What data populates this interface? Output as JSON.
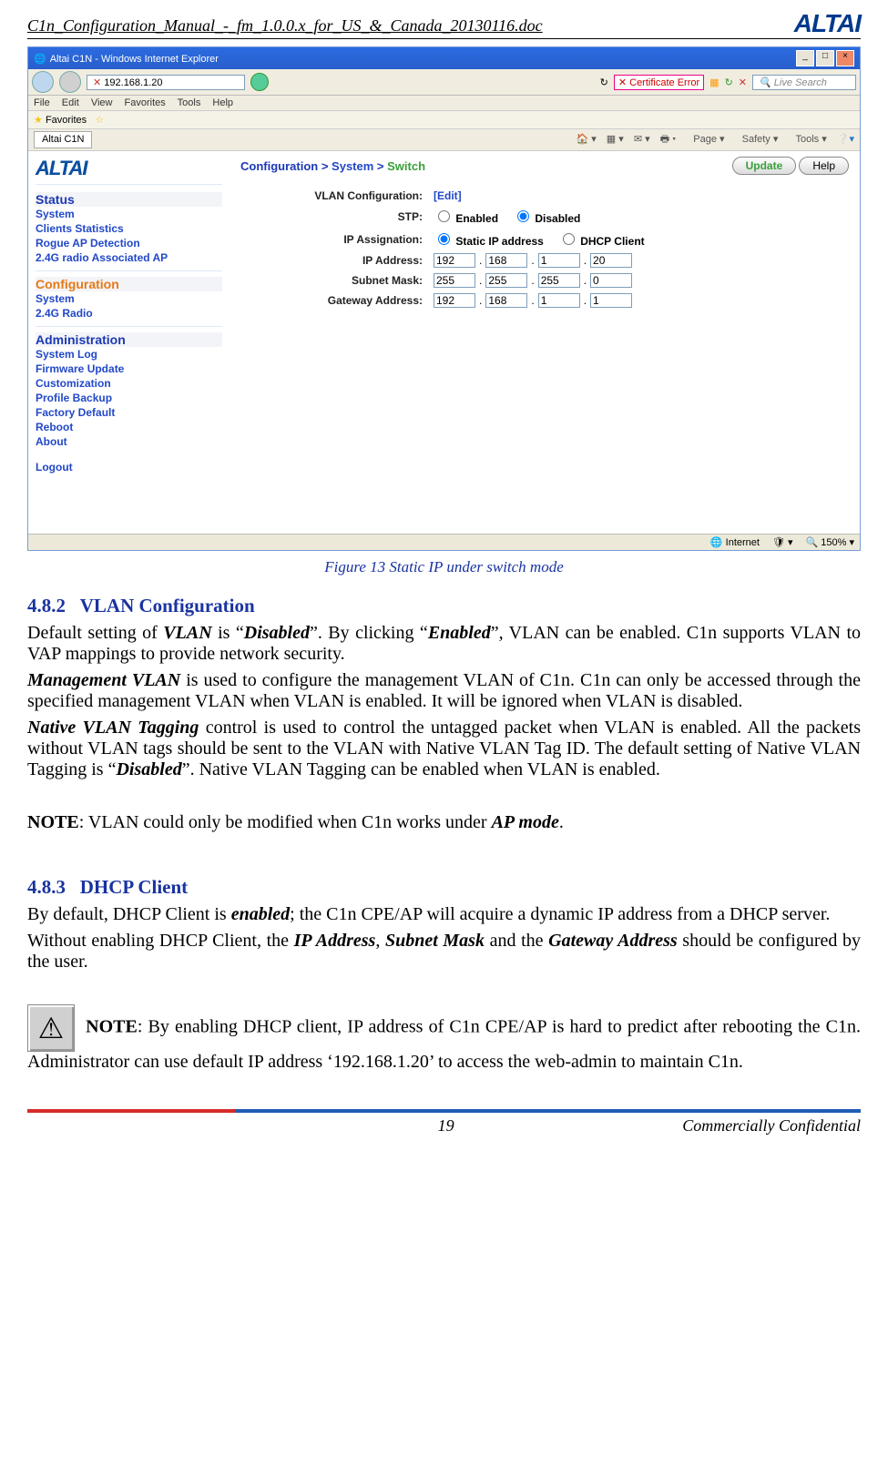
{
  "header": {
    "doc_title": "C1n_Configuration_Manual_-_fm_1.0.0.x_for_US_&_Canada_20130116.doc",
    "logo_text": "ALTAI"
  },
  "window": {
    "title": "Altai C1N - Windows Internet Explorer",
    "url": "192.168.1.20",
    "cert_error": "Certificate Error",
    "search_placeholder": "Live Search",
    "menubar": [
      "File",
      "Edit",
      "View",
      "Favorites",
      "Tools",
      "Help"
    ],
    "favorites_label": "Favorites",
    "tab_label": "Altai C1N",
    "toolbar_right": [
      "Page",
      "Safety",
      "Tools"
    ],
    "status_internet": "Internet",
    "status_zoom": "150%"
  },
  "sidebar": {
    "logo": "ALTAI",
    "status": {
      "heading": "Status",
      "items": [
        "System",
        "Clients Statistics",
        "Rogue AP Detection",
        "2.4G radio Associated AP"
      ]
    },
    "configuration": {
      "heading": "Configuration",
      "items": [
        "System",
        "2.4G Radio"
      ]
    },
    "administration": {
      "heading": "Administration",
      "items": [
        "System Log",
        "Firmware Update",
        "Customization",
        "Profile Backup",
        "Factory Default",
        "Reboot",
        "About"
      ]
    },
    "logout": "Logout"
  },
  "breadcrumb": {
    "label": "Configuration >",
    "l2": "System",
    "sep": ">",
    "l3": "Switch"
  },
  "buttons": {
    "update": "Update",
    "help": "Help"
  },
  "form": {
    "vlan_label": "VLAN Configuration:",
    "vlan_edit": "[Edit]",
    "stp_label": "STP:",
    "stp_enabled": "Enabled",
    "stp_disabled": "Disabled",
    "ip_assign_label": "IP Assignation:",
    "ip_static": "Static IP address",
    "ip_dhcp": "DHCP Client",
    "ip_addr_label": "IP Address:",
    "ip_addr": [
      "192",
      "168",
      "1",
      "20"
    ],
    "subnet_label": "Subnet Mask:",
    "subnet": [
      "255",
      "255",
      "255",
      "0"
    ],
    "gateway_label": "Gateway Address:",
    "gateway": [
      "192",
      "168",
      "1",
      "1"
    ]
  },
  "figure_caption": "Figure 13    Static IP under switch mode",
  "doc": {
    "h482_num": "4.8.2",
    "h482_title": "VLAN Configuration",
    "p1_a": "Default setting of ",
    "p1_vlan": "VLAN",
    "p1_b": " is “",
    "p1_disabled": "Disabled",
    "p1_c": "”. By clicking “",
    "p1_enabled": "Enabled",
    "p1_d": "”, VLAN can be enabled. C1n supports VLAN to VAP mappings to provide network security.",
    "p2_mv": "Management VLAN",
    "p2_rest": " is used to configure the management VLAN of C1n. C1n can only be accessed through the specified management VLAN when VLAN is enabled. It will be ignored when VLAN is disabled.",
    "p3_nvt": "Native VLAN Tagging",
    "p3_a": " control is used to control the untagged packet when VLAN is enabled. All the packets without VLAN tags should be sent to the VLAN with Native VLAN Tag ID. The default setting of Native VLAN Tagging is “",
    "p3_disabled": "Disabled",
    "p3_b": "”. Native VLAN Tagging can be enabled when VLAN is enabled.",
    "note1_label": "NOTE",
    "note1_rest": ": VLAN could only be modified when C1n works under ",
    "note1_ap": "AP mode",
    "note1_end": ".",
    "h483_num": "4.8.3",
    "h483_title": "DHCP Client",
    "p4_a": "By default, DHCP Client is ",
    "p4_en": "enabled",
    "p4_b": "; the C1n CPE/AP will acquire a dynamic IP address from a DHCP server.",
    "p5_a": "Without enabling DHCP Client, the ",
    "p5_ip": "IP Address",
    "p5_c1": ", ",
    "p5_sm": "Subnet Mask",
    "p5_c2": " and the ",
    "p5_gw": "Gateway Address",
    "p5_b": " should be configured by the user.",
    "note2_label": "NOTE",
    "note2_rest": ": By enabling DHCP client, IP address of C1n CPE/AP is hard to predict after rebooting the C1n. Administrator can use default IP address ‘192.168.1.20’ to access the web-admin to maintain C1n."
  },
  "footer": {
    "page": "19",
    "confidential": "Commercially Confidential"
  }
}
